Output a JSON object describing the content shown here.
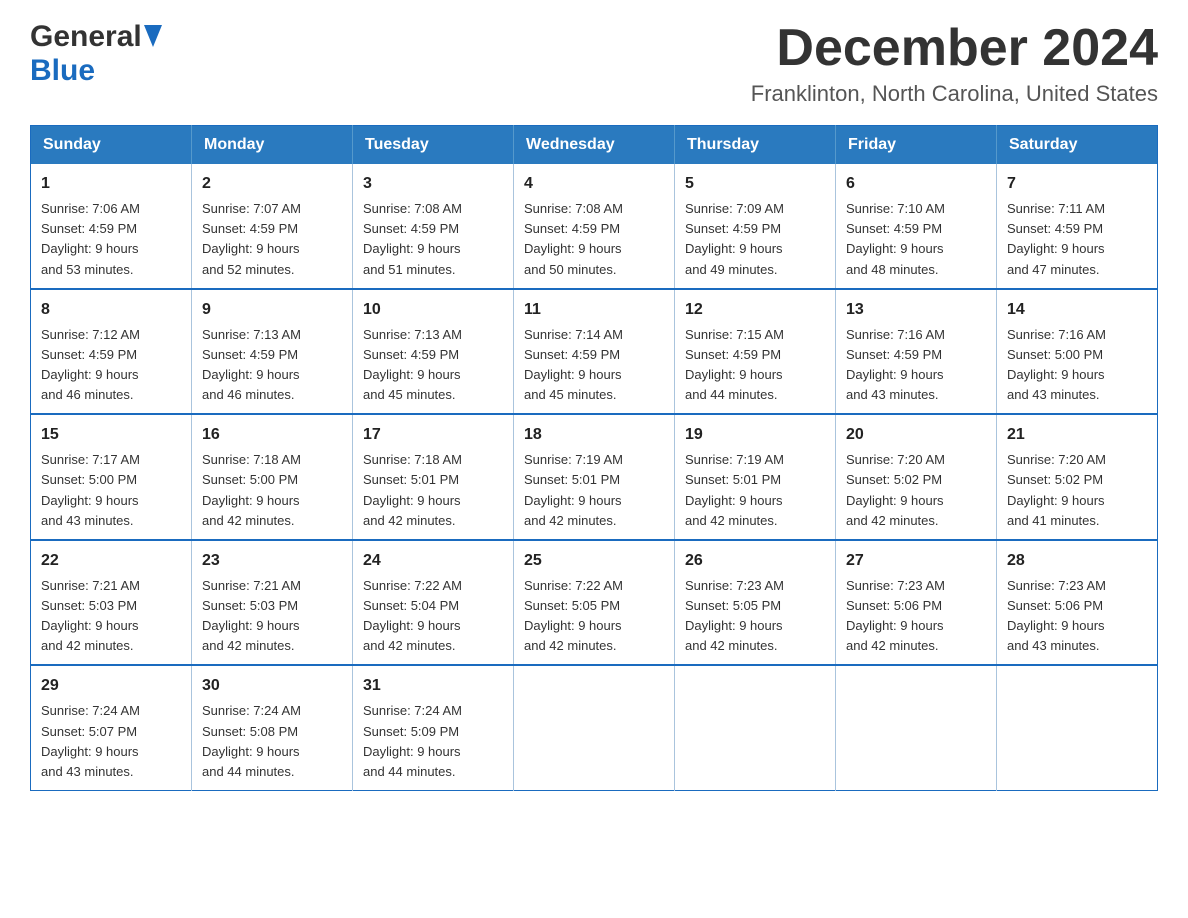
{
  "header": {
    "logo_general": "General",
    "logo_blue": "Blue",
    "month_title": "December 2024",
    "location": "Franklinton, North Carolina, United States"
  },
  "days_of_week": [
    "Sunday",
    "Monday",
    "Tuesday",
    "Wednesday",
    "Thursday",
    "Friday",
    "Saturday"
  ],
  "weeks": [
    [
      {
        "day": "1",
        "sunrise": "7:06 AM",
        "sunset": "4:59 PM",
        "daylight": "9 hours and 53 minutes."
      },
      {
        "day": "2",
        "sunrise": "7:07 AM",
        "sunset": "4:59 PM",
        "daylight": "9 hours and 52 minutes."
      },
      {
        "day": "3",
        "sunrise": "7:08 AM",
        "sunset": "4:59 PM",
        "daylight": "9 hours and 51 minutes."
      },
      {
        "day": "4",
        "sunrise": "7:08 AM",
        "sunset": "4:59 PM",
        "daylight": "9 hours and 50 minutes."
      },
      {
        "day": "5",
        "sunrise": "7:09 AM",
        "sunset": "4:59 PM",
        "daylight": "9 hours and 49 minutes."
      },
      {
        "day": "6",
        "sunrise": "7:10 AM",
        "sunset": "4:59 PM",
        "daylight": "9 hours and 48 minutes."
      },
      {
        "day": "7",
        "sunrise": "7:11 AM",
        "sunset": "4:59 PM",
        "daylight": "9 hours and 47 minutes."
      }
    ],
    [
      {
        "day": "8",
        "sunrise": "7:12 AM",
        "sunset": "4:59 PM",
        "daylight": "9 hours and 46 minutes."
      },
      {
        "day": "9",
        "sunrise": "7:13 AM",
        "sunset": "4:59 PM",
        "daylight": "9 hours and 46 minutes."
      },
      {
        "day": "10",
        "sunrise": "7:13 AM",
        "sunset": "4:59 PM",
        "daylight": "9 hours and 45 minutes."
      },
      {
        "day": "11",
        "sunrise": "7:14 AM",
        "sunset": "4:59 PM",
        "daylight": "9 hours and 45 minutes."
      },
      {
        "day": "12",
        "sunrise": "7:15 AM",
        "sunset": "4:59 PM",
        "daylight": "9 hours and 44 minutes."
      },
      {
        "day": "13",
        "sunrise": "7:16 AM",
        "sunset": "4:59 PM",
        "daylight": "9 hours and 43 minutes."
      },
      {
        "day": "14",
        "sunrise": "7:16 AM",
        "sunset": "5:00 PM",
        "daylight": "9 hours and 43 minutes."
      }
    ],
    [
      {
        "day": "15",
        "sunrise": "7:17 AM",
        "sunset": "5:00 PM",
        "daylight": "9 hours and 43 minutes."
      },
      {
        "day": "16",
        "sunrise": "7:18 AM",
        "sunset": "5:00 PM",
        "daylight": "9 hours and 42 minutes."
      },
      {
        "day": "17",
        "sunrise": "7:18 AM",
        "sunset": "5:01 PM",
        "daylight": "9 hours and 42 minutes."
      },
      {
        "day": "18",
        "sunrise": "7:19 AM",
        "sunset": "5:01 PM",
        "daylight": "9 hours and 42 minutes."
      },
      {
        "day": "19",
        "sunrise": "7:19 AM",
        "sunset": "5:01 PM",
        "daylight": "9 hours and 42 minutes."
      },
      {
        "day": "20",
        "sunrise": "7:20 AM",
        "sunset": "5:02 PM",
        "daylight": "9 hours and 42 minutes."
      },
      {
        "day": "21",
        "sunrise": "7:20 AM",
        "sunset": "5:02 PM",
        "daylight": "9 hours and 41 minutes."
      }
    ],
    [
      {
        "day": "22",
        "sunrise": "7:21 AM",
        "sunset": "5:03 PM",
        "daylight": "9 hours and 42 minutes."
      },
      {
        "day": "23",
        "sunrise": "7:21 AM",
        "sunset": "5:03 PM",
        "daylight": "9 hours and 42 minutes."
      },
      {
        "day": "24",
        "sunrise": "7:22 AM",
        "sunset": "5:04 PM",
        "daylight": "9 hours and 42 minutes."
      },
      {
        "day": "25",
        "sunrise": "7:22 AM",
        "sunset": "5:05 PM",
        "daylight": "9 hours and 42 minutes."
      },
      {
        "day": "26",
        "sunrise": "7:23 AM",
        "sunset": "5:05 PM",
        "daylight": "9 hours and 42 minutes."
      },
      {
        "day": "27",
        "sunrise": "7:23 AM",
        "sunset": "5:06 PM",
        "daylight": "9 hours and 42 minutes."
      },
      {
        "day": "28",
        "sunrise": "7:23 AM",
        "sunset": "5:06 PM",
        "daylight": "9 hours and 43 minutes."
      }
    ],
    [
      {
        "day": "29",
        "sunrise": "7:24 AM",
        "sunset": "5:07 PM",
        "daylight": "9 hours and 43 minutes."
      },
      {
        "day": "30",
        "sunrise": "7:24 AM",
        "sunset": "5:08 PM",
        "daylight": "9 hours and 44 minutes."
      },
      {
        "day": "31",
        "sunrise": "7:24 AM",
        "sunset": "5:09 PM",
        "daylight": "9 hours and 44 minutes."
      },
      null,
      null,
      null,
      null
    ]
  ],
  "labels": {
    "sunrise": "Sunrise:",
    "sunset": "Sunset:",
    "daylight": "Daylight:"
  }
}
